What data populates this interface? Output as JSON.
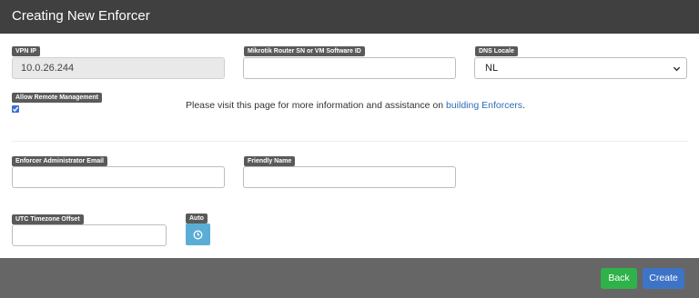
{
  "header": {
    "title": "Creating New Enforcer"
  },
  "fields": {
    "vpn_ip": {
      "label": "VPN IP",
      "value": "10.0.26.244"
    },
    "router_id": {
      "label": "Mikrotik Router SN or VM Software ID",
      "value": ""
    },
    "dns_locale": {
      "label": "DNS Locale",
      "value": "NL"
    },
    "remote_mgmt": {
      "label": "Allow Remote Management",
      "checked": true
    },
    "admin_email": {
      "label": "Enforcer Administrator Email",
      "value": ""
    },
    "friendly_name": {
      "label": "Friendly Name",
      "value": ""
    },
    "utc_offset": {
      "label": "UTC Timezone Offset",
      "value": ""
    },
    "auto": {
      "label": "Auto"
    }
  },
  "info": {
    "text": "Please visit this page for more information and assistance on ",
    "link": "building Enforcers",
    "suffix": "."
  },
  "footer": {
    "back_label": "Back",
    "create_label": "Create"
  },
  "colors": {
    "header_bg": "#404040",
    "footer_bg": "#666666",
    "back_button": "#2fb24a",
    "create_button": "#3e74c8",
    "auto_button": "#5aaed6",
    "link": "#2f6db5"
  },
  "icons": {
    "dns_dropdown": "chevron-down-icon",
    "auto_button": "clock-icon",
    "remote_mgmt": "checkmark-icon"
  }
}
